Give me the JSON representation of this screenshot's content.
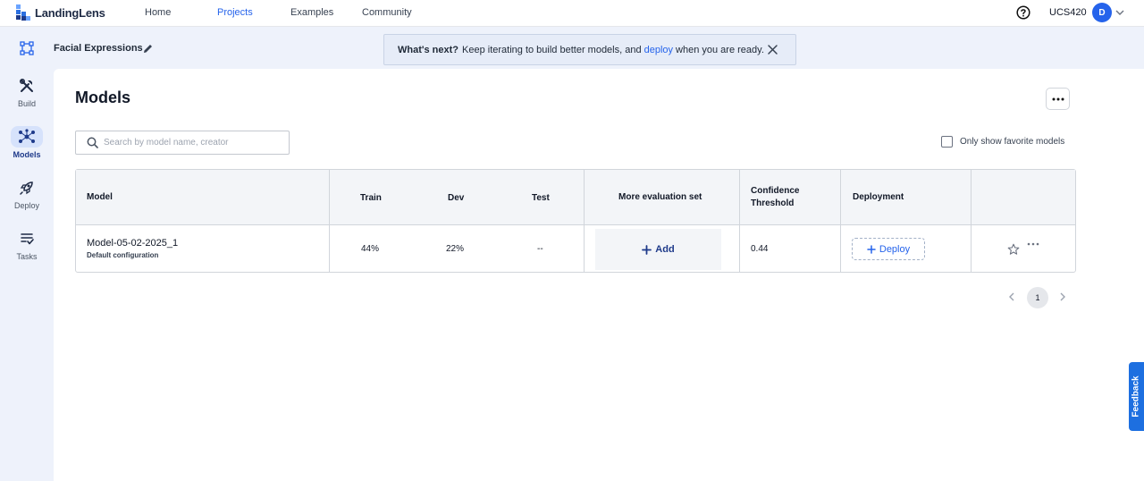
{
  "nav": {
    "brand": "LandingLens",
    "links": [
      {
        "label": "Home"
      },
      {
        "label": "Projects"
      },
      {
        "label": "Examples"
      },
      {
        "label": "Community"
      }
    ],
    "org_name": "UCS420",
    "avatar_initial": "D"
  },
  "sidebar": {
    "items": [
      {
        "label": "Build",
        "icon": "tools-icon"
      },
      {
        "label": "Models",
        "icon": "network-icon"
      },
      {
        "label": "Deploy",
        "icon": "rocket-icon"
      },
      {
        "label": "Tasks",
        "icon": "checklist-icon"
      }
    ]
  },
  "project": {
    "name": "Facial Expressions"
  },
  "banner": {
    "lead": "What's next?",
    "text_before": "Keep iterating to build better models, and",
    "link": "deploy",
    "text_after": "when you are ready."
  },
  "page": {
    "title": "Models",
    "search_placeholder": "Search by model name, creator",
    "favorites_label": "Only show favorite models"
  },
  "table": {
    "headers": {
      "model": "Model",
      "train": "Train",
      "dev": "Dev",
      "test": "Test",
      "more_eval": "More evaluation set",
      "confidence_line1": "Confidence",
      "confidence_line2": "Threshold",
      "deployment": "Deployment"
    },
    "rows": [
      {
        "model_name": "Model-05-02-2025_1",
        "config": "Default configuration",
        "train": "44%",
        "dev": "22%",
        "test": "--",
        "add_label": "Add",
        "confidence": "0.44",
        "deploy_label": "Deploy"
      }
    ]
  },
  "pagination": {
    "current_page": "1"
  },
  "feedback_label": "Feedback",
  "colors": {
    "accent": "#2563eb",
    "feedback": "#1d6fe0"
  }
}
